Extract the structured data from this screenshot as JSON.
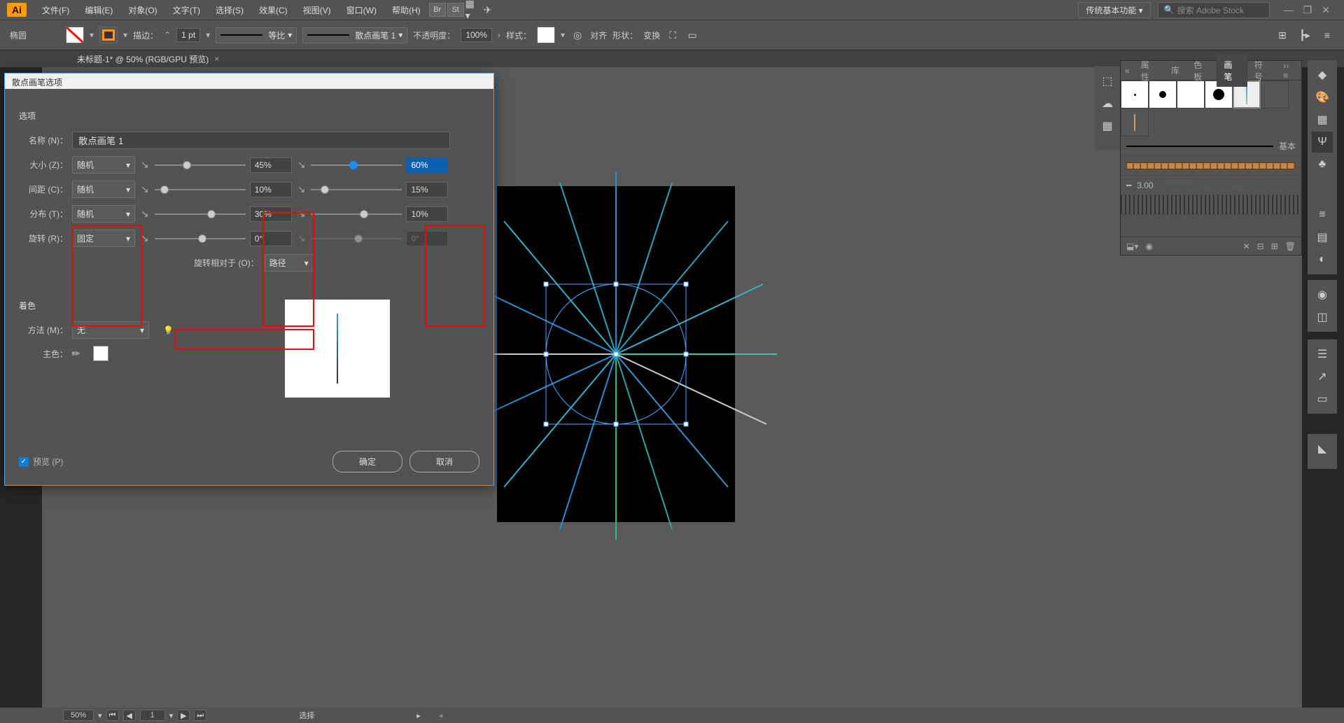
{
  "app": {
    "logo": "Ai"
  },
  "menubar": {
    "items": [
      "文件(F)",
      "编辑(E)",
      "对象(O)",
      "文字(T)",
      "选择(S)",
      "效果(C)",
      "视图(V)",
      "窗口(W)",
      "帮助(H)"
    ],
    "br": "Br",
    "st": "St",
    "workspace": "传统基本功能",
    "search_placeholder": "搜索 Adobe Stock"
  },
  "controlbar": {
    "shape": "椭圆",
    "stroke_label": "描边：",
    "stroke_weight": "1 pt",
    "stroke_profile": "等比",
    "brush_label": "散点画笔 1",
    "opacity_label": "不透明度：",
    "opacity": "100%",
    "style_label": "样式：",
    "align_label": "对齐",
    "shape2": "形状：",
    "transform": "变换"
  },
  "tab": {
    "title": "未标题-1* @ 50% (RGB/GPU 预览)",
    "close": "×"
  },
  "dialog": {
    "title": "散点画笔选项",
    "options_label": "选项",
    "name_label": "名称 (N)：",
    "name_value": "散点画笔 1",
    "size_label": "大小 (Z)：",
    "spacing_label": "间距 (C)：",
    "scatter_label": "分布 (T)：",
    "rotation_label": "旋转 (R)：",
    "random": "随机",
    "fixed": "固定",
    "size_v1": "45%",
    "size_v2": "60%",
    "spacing_v1": "10%",
    "spacing_v2": "15%",
    "scatter_v1": "30%",
    "scatter_v2": "10%",
    "rot_v1": "0°",
    "rot_v2": "0°",
    "rot_rel_label": "旋转相对于 (O)：",
    "rot_rel_value": "路径",
    "color_label": "着色",
    "method_label": "方法 (M)：",
    "method_value": "无",
    "key_label": "主色：",
    "preview_label": "预览 (P)",
    "ok": "确定",
    "cancel": "取消"
  },
  "panel": {
    "tabs": [
      "属性",
      "库",
      "色板",
      "画笔",
      "符号"
    ],
    "basic_label": "基本",
    "brush_size": "3.00"
  },
  "statusbar": {
    "zoom": "50%",
    "page": "1",
    "mode": "选择"
  }
}
